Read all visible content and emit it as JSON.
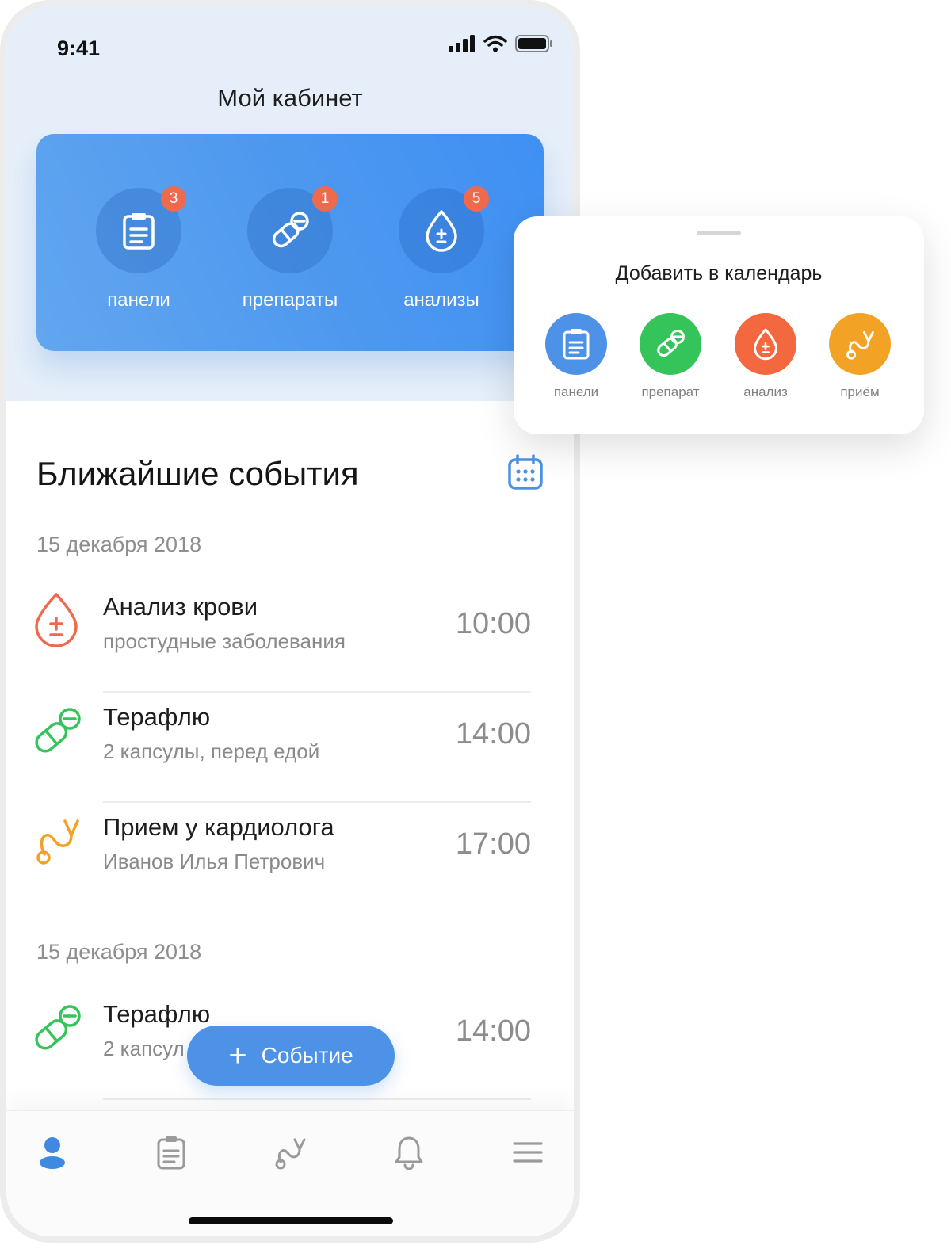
{
  "status_bar": {
    "time": "9:41"
  },
  "header": {
    "title": "Мой кабинет"
  },
  "dashboard": {
    "items": [
      {
        "label": "панели",
        "badge": "3",
        "icon": "clipboard-icon"
      },
      {
        "label": "препараты",
        "badge": "1",
        "icon": "pill-icon"
      },
      {
        "label": "анализы",
        "badge": "5",
        "icon": "drop-icon"
      }
    ]
  },
  "events": {
    "title": "Ближайшие события",
    "groups": [
      {
        "date": "15 декабря 2018",
        "items": [
          {
            "title": "Анализ крови",
            "subtitle": "простудные заболевания",
            "time": "10:00",
            "icon": "drop-icon",
            "color": "#ef6a4d"
          },
          {
            "title": "Терафлю",
            "subtitle": "2 капсулы, перед едой",
            "time": "14:00",
            "icon": "pill-icon",
            "color": "#35c45a"
          },
          {
            "title": "Прием у кардиолога",
            "subtitle": "Иванов Илья Петрович",
            "time": "17:00",
            "icon": "stethoscope-icon",
            "color": "#f2a325"
          }
        ]
      },
      {
        "date": "15 декабря 2018",
        "items": [
          {
            "title": "Терафлю",
            "subtitle": "2 капсул",
            "time": "14:00",
            "icon": "pill-icon",
            "color": "#35c45a"
          }
        ]
      }
    ]
  },
  "fab": {
    "label": "Событие"
  },
  "popup": {
    "title": "Добавить в календарь",
    "items": [
      {
        "label": "панели",
        "color": "#4d92e6",
        "icon": "clipboard-icon"
      },
      {
        "label": "препарат",
        "color": "#35c45a",
        "icon": "pill-icon"
      },
      {
        "label": "анализ",
        "color": "#f4683f",
        "icon": "drop-icon"
      },
      {
        "label": "приём",
        "color": "#f2a325",
        "icon": "stethoscope-icon"
      }
    ]
  },
  "tabbar": {
    "tabs": [
      "profile-icon",
      "clipboard-icon",
      "stethoscope-icon",
      "bell-icon",
      "menu-icon"
    ],
    "active_color": "#3f8ae0",
    "inactive_color": "#9a9a9a"
  }
}
